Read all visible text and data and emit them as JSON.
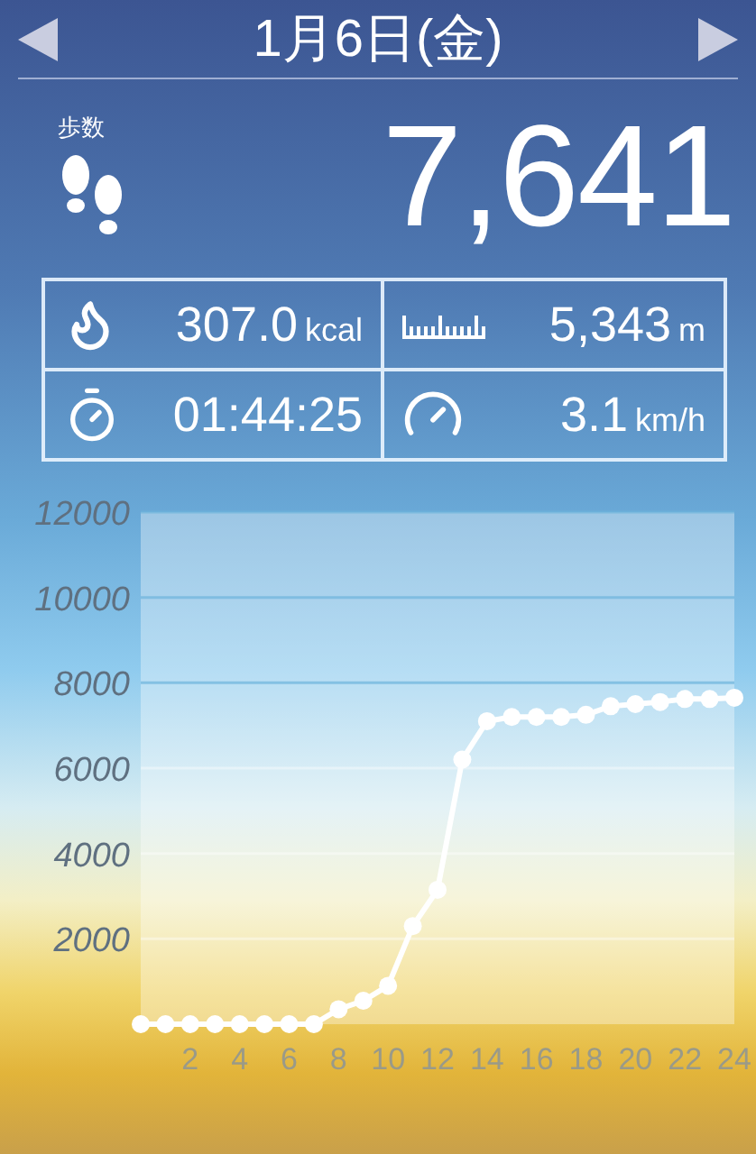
{
  "header": {
    "date": "1月6日(金)"
  },
  "steps": {
    "label": "歩数",
    "value": "7,641"
  },
  "stats": [
    {
      "kind": "calories",
      "value": "307.0",
      "unit": "kcal"
    },
    {
      "kind": "distance",
      "value": "5,343",
      "unit": "m"
    },
    {
      "kind": "time",
      "value": "01:44:25"
    },
    {
      "kind": "speed",
      "value": "3.1",
      "unit": "km/h"
    }
  ],
  "chart": {
    "chart_data": {
      "type": "line",
      "x": [
        0,
        1,
        2,
        3,
        4,
        5,
        6,
        7,
        8,
        9,
        10,
        11,
        12,
        13,
        14,
        15,
        16,
        17,
        18,
        19,
        20,
        21,
        22,
        23,
        24
      ],
      "values": [
        0,
        0,
        0,
        0,
        0,
        0,
        0,
        0,
        350,
        550,
        900,
        2300,
        3150,
        6200,
        7100,
        7200,
        7200,
        7200,
        7250,
        7450,
        7500,
        7550,
        7620,
        7620,
        7650
      ],
      "grid": true,
      "marker": true,
      "xlim": [
        0,
        24
      ],
      "ylim": [
        0,
        12000
      ],
      "xticks": [
        2,
        4,
        6,
        8,
        10,
        12,
        14,
        16,
        18,
        20,
        22,
        24
      ],
      "yticks": [
        2000,
        4000,
        6000,
        8000,
        10000,
        12000
      ]
    }
  }
}
